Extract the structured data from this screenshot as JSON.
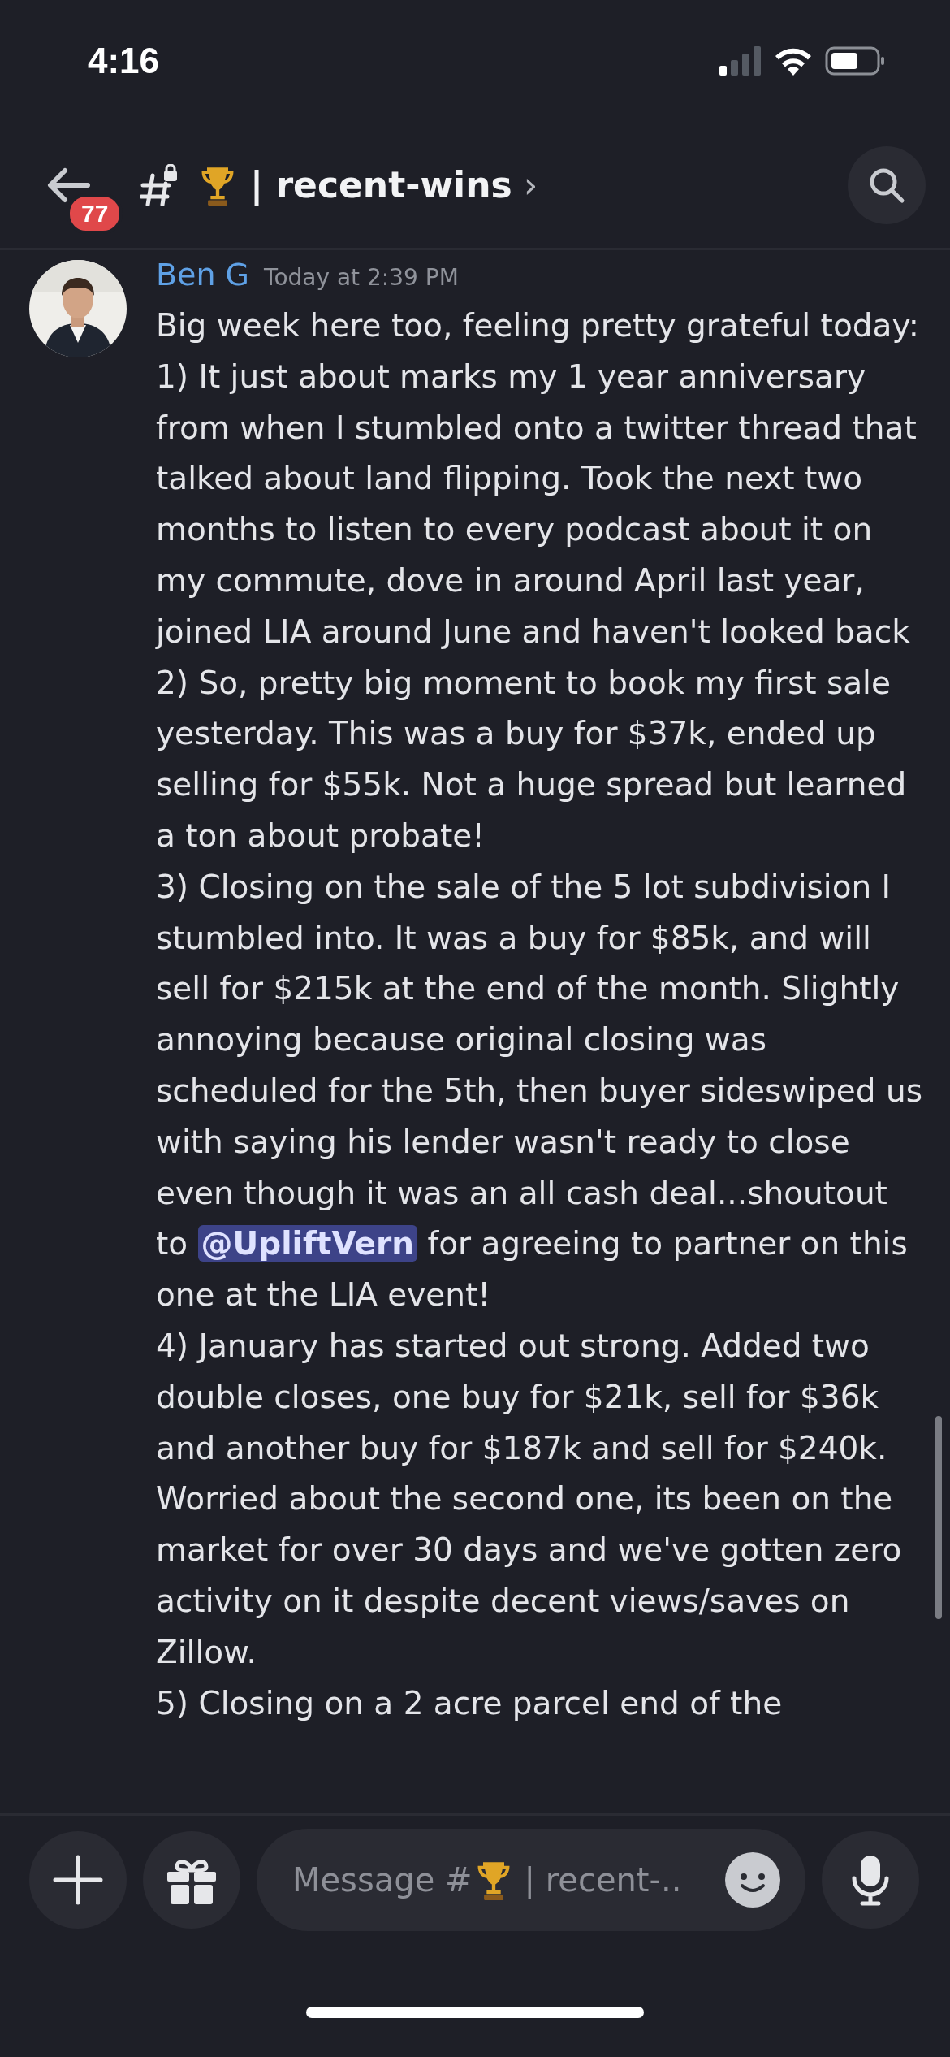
{
  "status_bar": {
    "time": "4:16"
  },
  "header": {
    "unread_badge": "77",
    "channel_name": "| recent-wins",
    "chevron": "›"
  },
  "message": {
    "author": "Ben G",
    "timestamp": "Today at 2:39 PM",
    "paragraphs": [
      {
        "text": "Big week here too, feeling pretty grateful today:"
      },
      {
        "text": "1) It just about marks my 1 year anniversary from when I stumbled onto a twitter thread that talked about land flipping. Took the next two months to listen to every podcast about it on my commute, dove in around April last year, joined LIA around June and haven't looked back"
      },
      {
        "text": "2) So, pretty big moment to book my first sale yesterday. This was a buy for $37k, ended up selling for $55k. Not a huge spread but learned a ton about probate!"
      },
      {
        "text": "3) Closing on the sale of the 5 lot subdivision I stumbled into. It was a buy for $85k, and will sell for $215k at the end of the month. Slightly annoying because original closing was scheduled for the 5th, then buyer sideswiped us with saying his lender wasn't ready to close even though it was an all cash deal...shoutout to ",
        "mention": "@UpliftVern",
        "text_after": " for agreeing to partner on this one at the LIA event!"
      },
      {
        "text": "4) January has started out strong. Added two double closes, one buy for $21k, sell for $36k and another buy for $187k and sell for $240k. Worried about the second one, its been on the market for over 30 days and we've gotten zero activity on it despite decent views/saves on Zillow."
      },
      {
        "text": "5) Closing on a 2 acre parcel end of the"
      }
    ]
  },
  "composer": {
    "placeholder_start": "Message #",
    "placeholder_end": "| recent-.."
  }
}
